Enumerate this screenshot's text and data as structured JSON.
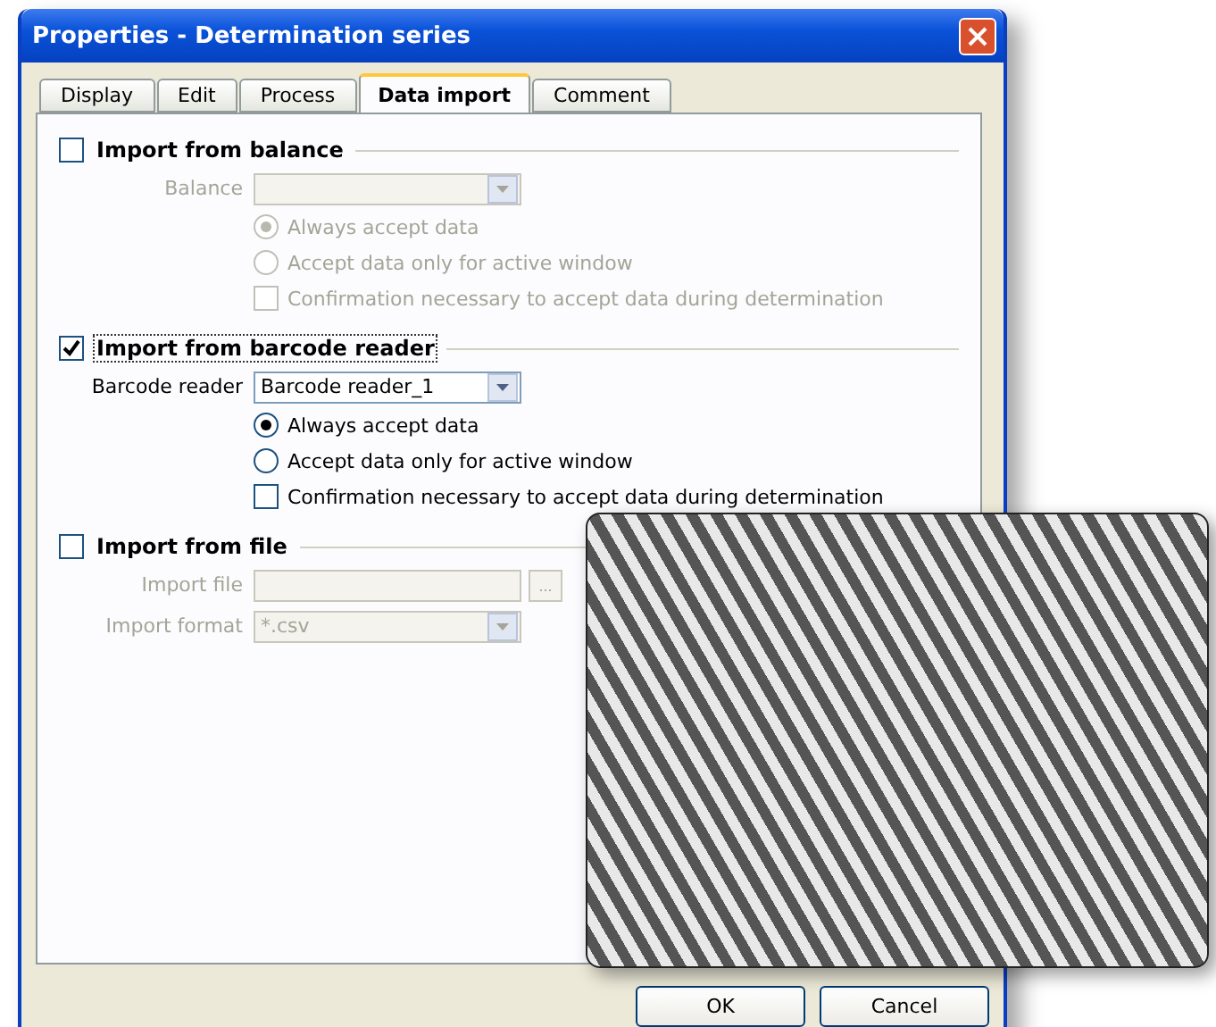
{
  "window": {
    "title": "Properties - Determination series"
  },
  "tabs": [
    {
      "label": "Display",
      "selected": false
    },
    {
      "label": "Edit",
      "selected": false
    },
    {
      "label": "Process",
      "selected": false
    },
    {
      "label": "Data import",
      "selected": true
    },
    {
      "label": "Comment",
      "selected": false
    }
  ],
  "sections": [
    {
      "label": "Import from balance",
      "checked": false,
      "focused": false,
      "fields": [
        {
          "kind": "select",
          "label": "Balance"
        }
      ],
      "radios": [
        {
          "label": "Always accept data",
          "selected": true
        },
        {
          "label": "Accept data only for active window",
          "selected": false
        }
      ],
      "confirm": {
        "label": "Confirmation necessary to accept data during determination",
        "checked": false
      }
    },
    {
      "label": "Import from barcode reader",
      "checked": true,
      "focused": true,
      "fields": [
        {
          "kind": "select",
          "label": "Barcode reader",
          "value": "Barcode reader_1"
        }
      ],
      "radios": [
        {
          "label": "Always accept data",
          "selected": true
        },
        {
          "label": "Accept data only for active window",
          "selected": false
        }
      ],
      "confirm": {
        "label": "Confirmation necessary to accept data during determination",
        "checked": false
      }
    },
    {
      "label": "Import from file",
      "checked": false,
      "focused": false,
      "fields": [
        {
          "kind": "file",
          "label": "Import file",
          "browse": "..."
        },
        {
          "kind": "select",
          "label": "Import format",
          "value": "*.csv"
        }
      ]
    }
  ],
  "buttons": [
    "OK",
    "Cancel"
  ]
}
